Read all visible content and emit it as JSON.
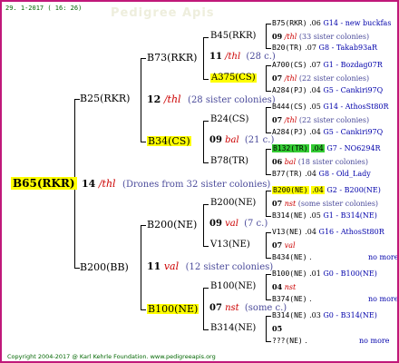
{
  "header": {
    "date": "29.  1-2017  ( 16: 26)"
  },
  "watermark": "Pedigree Apis",
  "root": {
    "id": "B65(RKR)",
    "year": "14",
    "breed": "/thl",
    "note": "(Drones from 32 sister colonies)"
  },
  "gen2": {
    "top": {
      "id": "B25(RKR)",
      "year": "12",
      "breed": "/thl",
      "note": "(28 sister colonies)"
    },
    "bottom": {
      "id": "B200(BB)",
      "year": "11",
      "breed": "val",
      "note": "(12 sister colonies)"
    }
  },
  "gen3": [
    {
      "id": "B73(RKR)",
      "year": "11",
      "breed": "/thl",
      "note": "(28 c.)"
    },
    {
      "id": "B34(CS)",
      "year": "09",
      "breed": "bal",
      "note": "(21 c.)"
    },
    {
      "id": "B200(NE)",
      "year": "09",
      "breed": "val",
      "note": "(7 c.)"
    },
    {
      "id": "B100(NE)",
      "year": "07",
      "breed": "nst",
      "note": "(some c.)"
    }
  ],
  "gen4": [
    {
      "id": "B45(RKR)",
      "year": "09",
      "breed": "/thl",
      "note": "(33 sister colonies)"
    },
    {
      "id": "A375(CS)",
      "year": "07",
      "breed": "/thl",
      "note": "(22 sister colonies)"
    },
    {
      "id": "B24(CS)",
      "year": "07",
      "breed": "/thl",
      "note": "(22 sister colonies)"
    },
    {
      "id": "B78(TR)",
      "year": "06",
      "breed": "bal",
      "note": "(18 sister colonies)"
    },
    {
      "id": "B200(NE)",
      "year": "07",
      "breed": "nst",
      "note": "(some sister colonies)"
    },
    {
      "id": "V13(NE)",
      "year": "07",
      "breed": "val",
      "note": ""
    },
    {
      "id": "B100(NE)",
      "year": "04",
      "breed": "nst",
      "note": ""
    },
    {
      "id": "B314(NE)",
      "year": "05",
      "breed": "",
      "note": ""
    }
  ],
  "gen5": [
    {
      "id": "B75(RKR)",
      "val": ".06",
      "code": "G14 - new buckfas"
    },
    {
      "id": "B20(TR)",
      "val": ".07",
      "code": "G8 - Takab93aR"
    },
    {
      "id": "A700(CS)",
      "val": ".07",
      "code": "G1 - Bozdag07R"
    },
    {
      "id": "A284(PJ)",
      "val": ".04",
      "code": "G5 - Cankiri97Q"
    },
    {
      "id": "B444(CS)",
      "val": ".05",
      "code": "G14 - AthosSt80R"
    },
    {
      "id": "A284(PJ)",
      "val": ".04",
      "code": "G5 - Cankiri97Q"
    },
    {
      "id": "B132(TR)",
      "val": ".04",
      "code": "G7 - NO6294R"
    },
    {
      "id": "B77(TR)",
      "val": ".04",
      "code": "G8 - Old_Lady"
    },
    {
      "id": "B200(NE)",
      "val": ".04",
      "code": "G2 - B200(NE)"
    },
    {
      "id": "B314(NE)",
      "val": ".05",
      "code": "G1 - B314(NE)"
    },
    {
      "id": "V13(NE)",
      "val": ".04",
      "code": "G16 - AthosSt80R"
    },
    {
      "id": "B434(NE)",
      "val": ".",
      "code": "no more"
    },
    {
      "id": "B100(NE)",
      "val": ".01",
      "code": "G0 - B100(NE)"
    },
    {
      "id": "B374(NE)",
      "val": ".",
      "code": "no more"
    },
    {
      "id": "B314(NE)",
      "val": ".03",
      "code": "G0 - B314(NE)"
    },
    {
      "id": "???(NE)",
      "val": ".",
      "code": "no more"
    }
  ],
  "footer": "Copyright 2004-2017 @ Karl Kehrle Foundation.   www.pedigreeapis.org",
  "colors": {
    "border": "#c0187a",
    "highlight_yellow": "#ffff00",
    "highlight_green": "#33cc33",
    "breed_red": "#cc0000",
    "note_blue": "#4a4a9a",
    "code_blue": "#0000aa",
    "header_green": "#006600"
  }
}
